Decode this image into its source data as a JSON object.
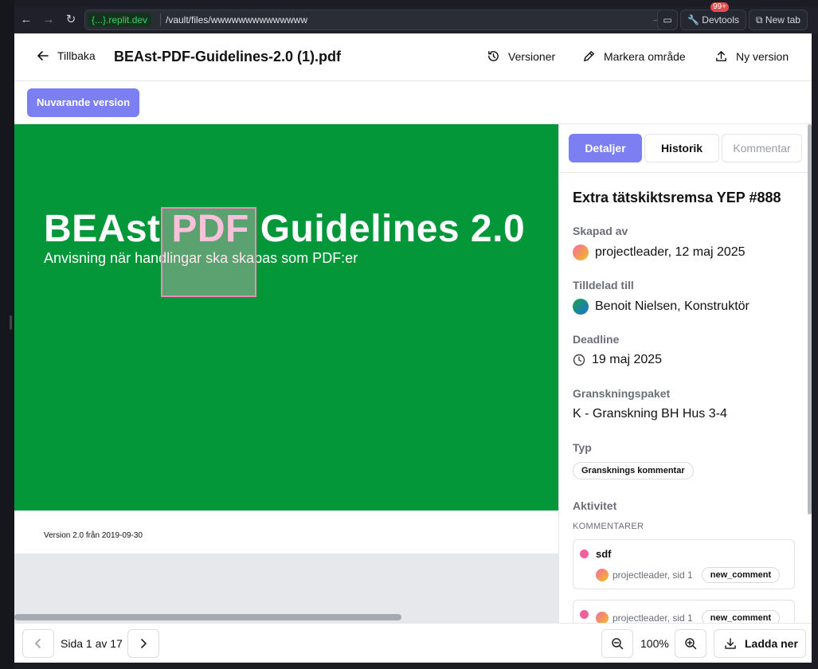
{
  "browser": {
    "url_chip_brace": "{...}",
    "url_chip_domain": ".replit.dev",
    "url_path": "/vault/files/wwwwwwwwwwwwww",
    "devtools_label": "Devtools",
    "devtools_badge": "99+",
    "new_tab_label": "New tab"
  },
  "header": {
    "back_label": "Tillbaka",
    "file_title": "BEAst-PDF-Guidelines-2.0 (1).pdf",
    "actions": {
      "versions": "Versioner",
      "mark_area": "Markera område",
      "new_version": "Ny version"
    }
  },
  "subbar": {
    "current_version_label": "Nuvarande version"
  },
  "document": {
    "cover_title_part1": "BEAst ",
    "cover_title_part2": "PDF",
    "cover_title_part3": " Guidelines 2.0",
    "cover_subtitle": "Anvisning när handlingar ska skapas som PDF:er",
    "version_line": "Version 2.0 från 2019-09-30",
    "cover_color": "#03973a",
    "mark_color": "#f08ab5"
  },
  "panel": {
    "tabs": [
      {
        "label": "Detaljer",
        "active": true
      },
      {
        "label": "Historik",
        "active": false
      },
      {
        "label": "Kommentar",
        "active": false
      }
    ],
    "issue_title": "Extra tätskiktsremsa YEP #888",
    "created_by_label": "Skapad av",
    "created_by_value": "projectleader, 12 maj 2025",
    "assigned_label": "Tilldelad till",
    "assigned_value": "Benoit Nielsen, Konstruktör",
    "deadline_label": "Deadline",
    "deadline_value": "19 maj 2025",
    "package_label": "Granskningspaket",
    "package_value": "K - Granskning BH Hus 3-4",
    "type_label": "Typ",
    "type_value": "Gransknings kommentar",
    "activity_label": "Aktivitet",
    "comments_caption": "KOMMENTARER",
    "comments": [
      {
        "text": "sdf",
        "meta": "projectleader, sid 1",
        "tag": "new_comment"
      },
      {
        "text": "",
        "meta": "projectleader, sid 1",
        "tag": "new_comment"
      }
    ],
    "accent_color": "#7b7ff2"
  },
  "footer": {
    "page_indicator": "Sida 1 av 17",
    "zoom": "100%",
    "download_label": "Ladda ner"
  }
}
